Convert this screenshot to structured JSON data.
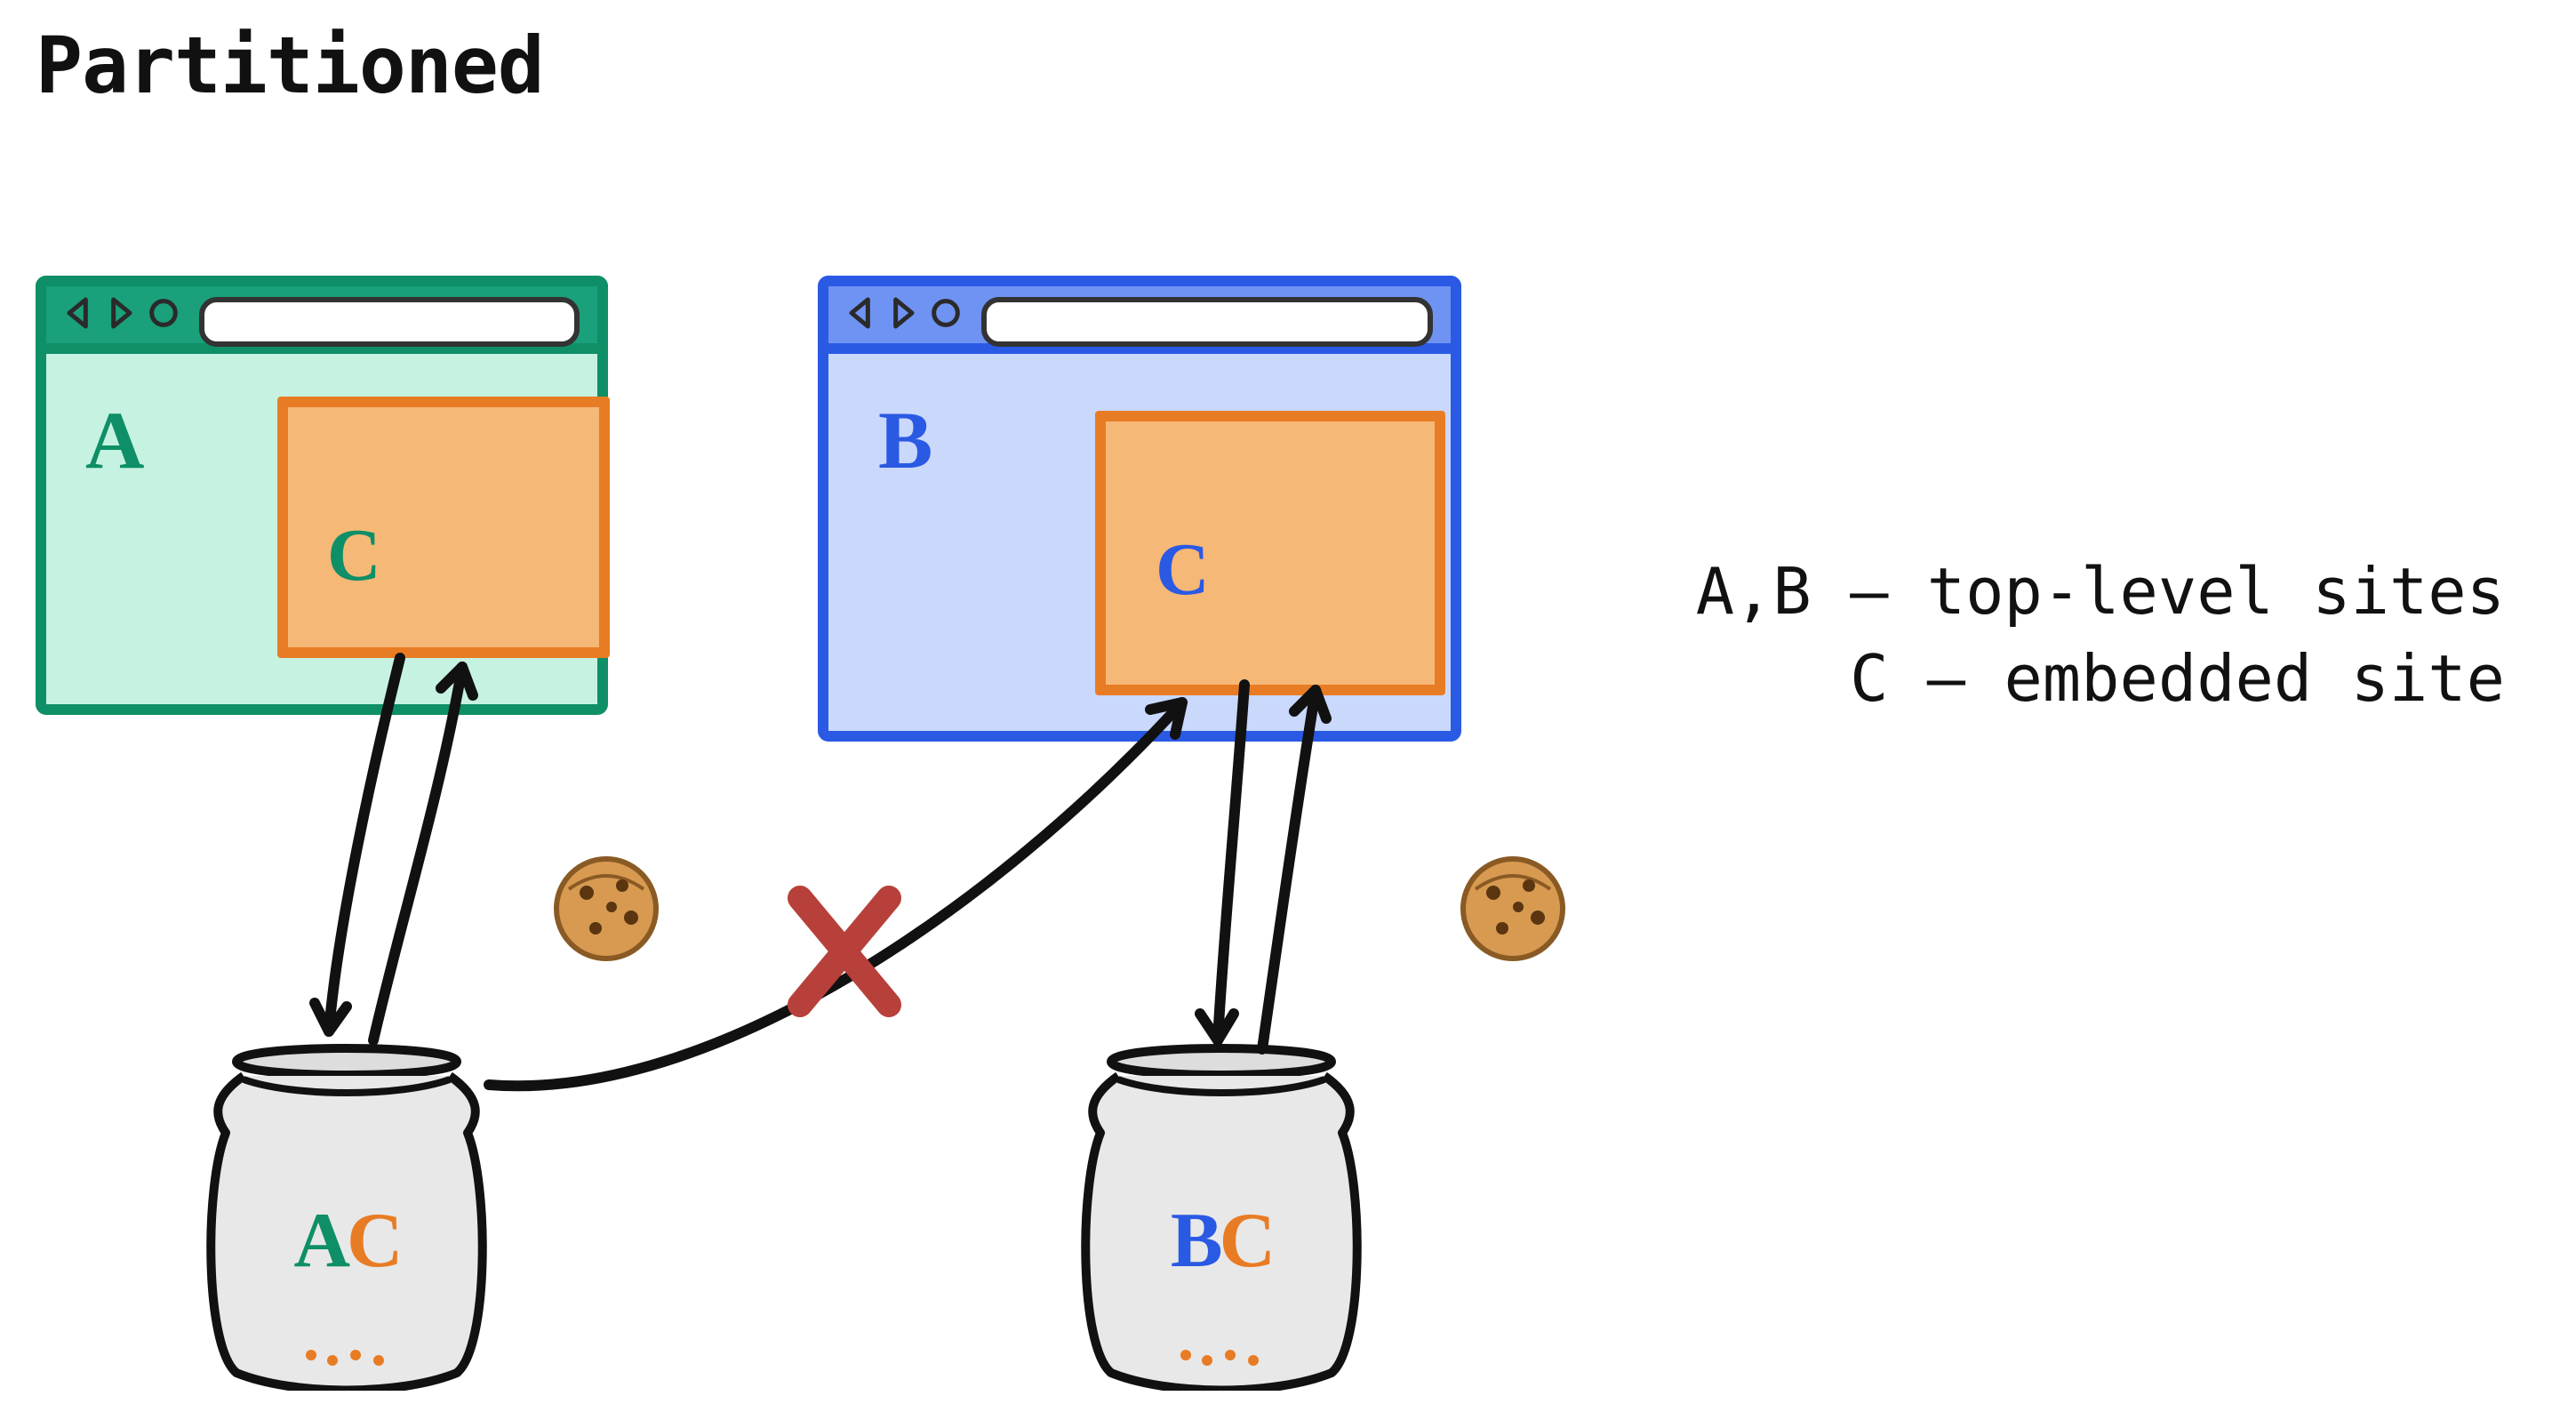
{
  "title": "Partitioned",
  "browser_a": {
    "label": "A",
    "embed_label": "C",
    "color": "#0e8f67"
  },
  "browser_b": {
    "label": "B",
    "embed_label": "C",
    "color": "#2a5ae4"
  },
  "jar_ac": {
    "letter1": "A",
    "letter2": "C",
    "letter1_color": "#0e8f67"
  },
  "jar_bc": {
    "letter1": "B",
    "letter2": "C",
    "letter1_color": "#2a5ae4"
  },
  "legend": {
    "line1": "A,B – top-level sites",
    "line2": "C – embedded site"
  },
  "blocked_arrow": {
    "symbol": "X",
    "color": "#b8403a"
  },
  "cookie_color": "#c98a3f",
  "embed_color": "#e87c24"
}
